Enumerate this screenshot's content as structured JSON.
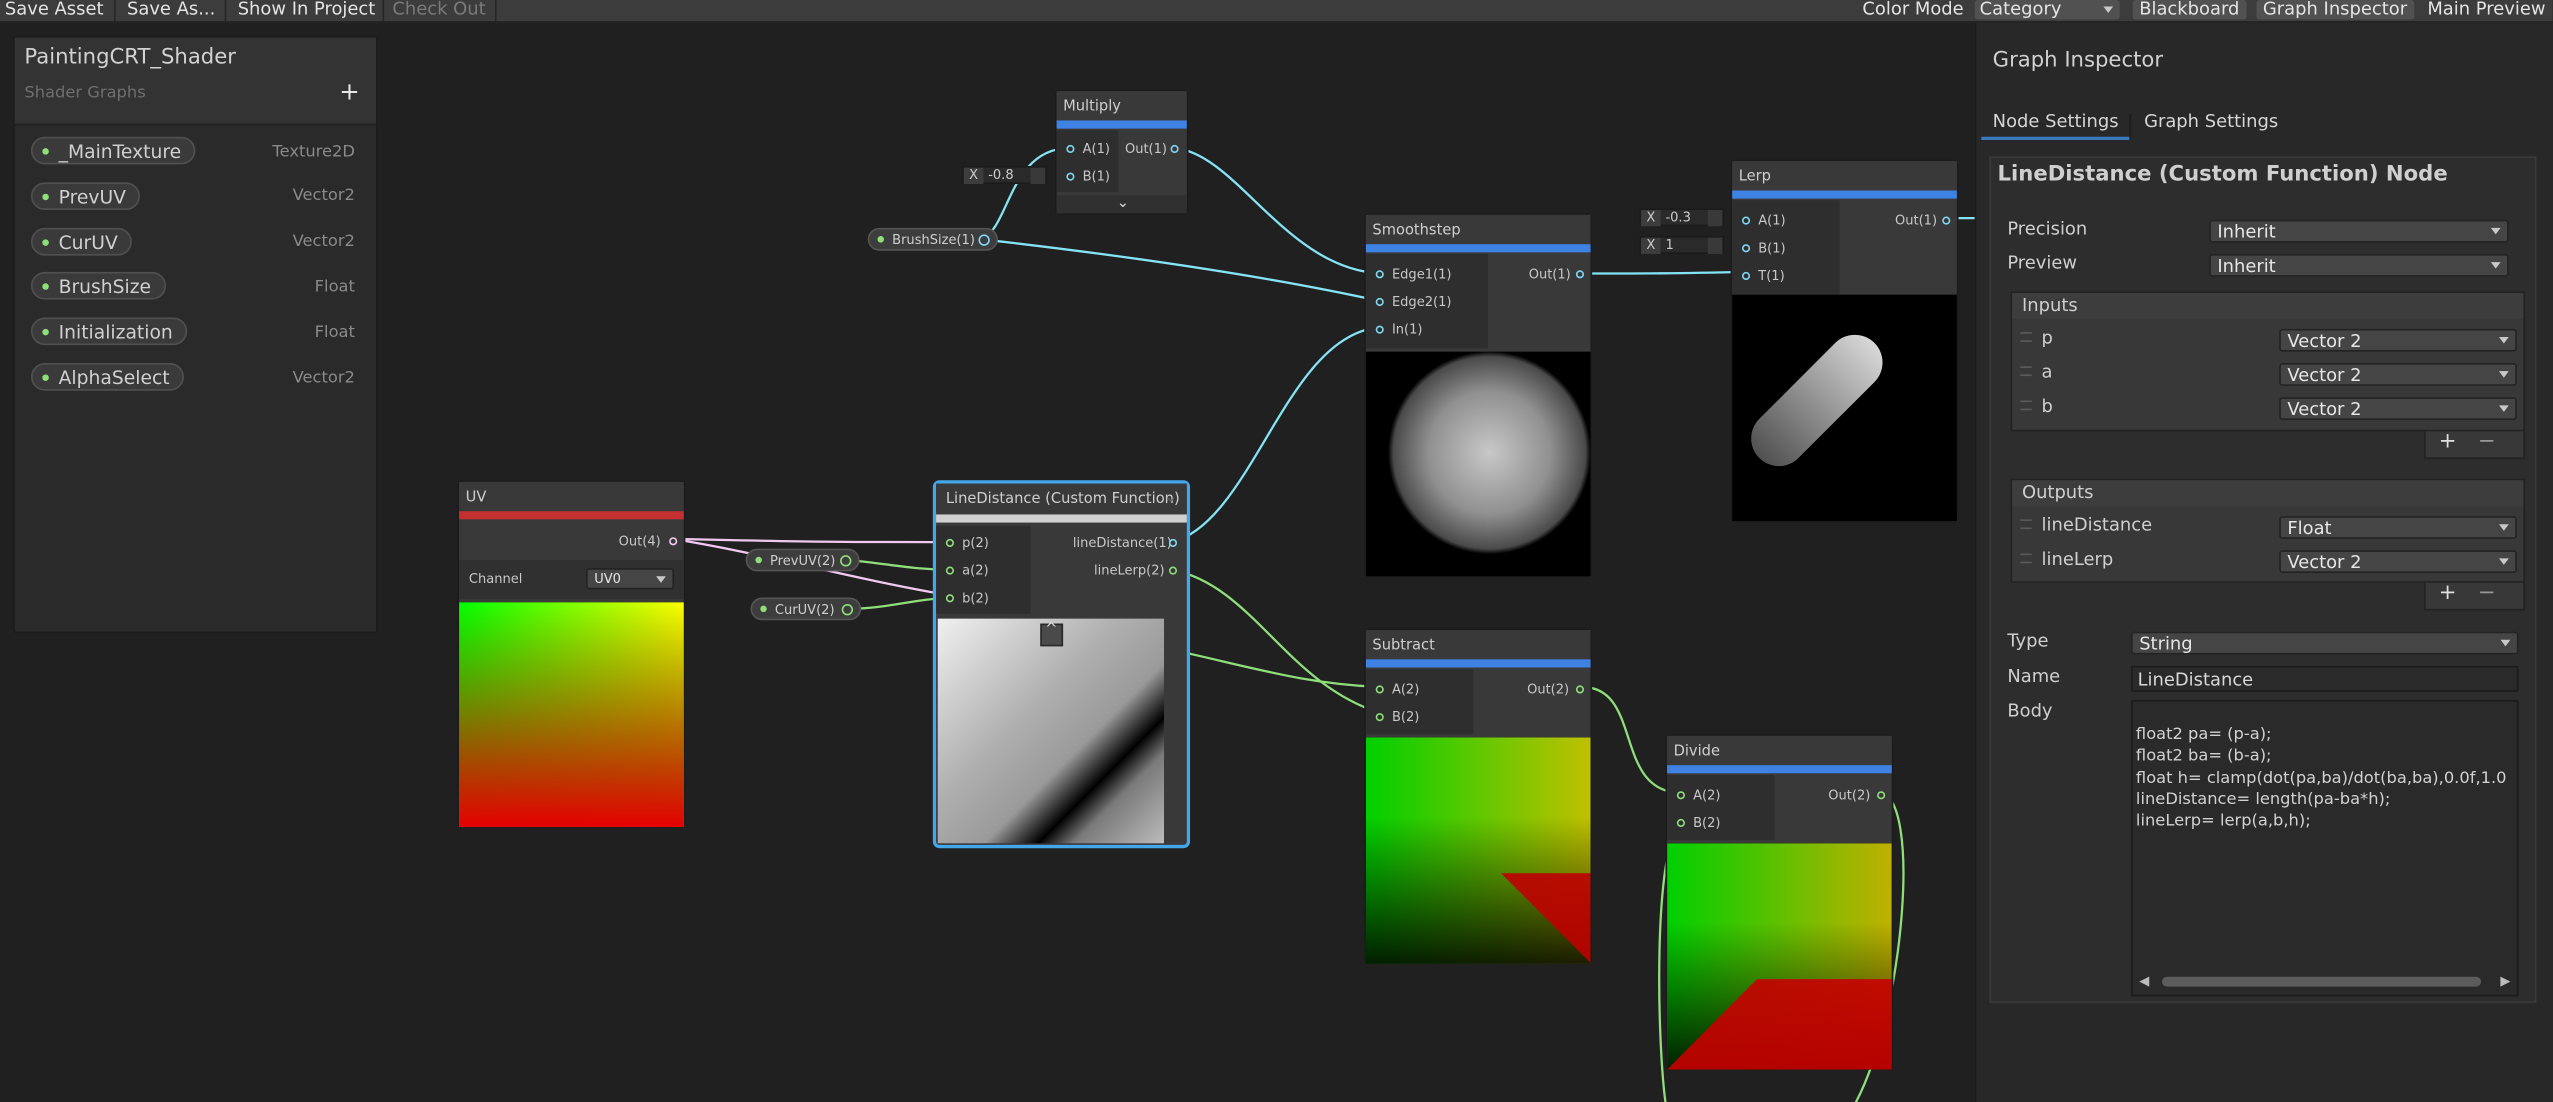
{
  "toolbar": {
    "save_asset": "Save Asset",
    "save_as": "Save As...",
    "show_in_project": "Show In Project",
    "check_out": "Check Out",
    "color_mode_label": "Color Mode",
    "color_mode_value": "Category",
    "blackboard": "Blackboard",
    "graph_inspector": "Graph Inspector",
    "main_preview": "Main Preview"
  },
  "blackboard": {
    "title": "PaintingCRT_Shader",
    "subtitle": "Shader Graphs",
    "add": "+",
    "properties": [
      {
        "name": "_MainTexture",
        "type": "Texture2D"
      },
      {
        "name": "PrevUV",
        "type": "Vector2"
      },
      {
        "name": "CurUV",
        "type": "Vector2"
      },
      {
        "name": "BrushSize",
        "type": "Float"
      },
      {
        "name": "Initialization",
        "type": "Float"
      },
      {
        "name": "AlphaSelect",
        "type": "Vector2"
      }
    ]
  },
  "nodes": {
    "multiply": {
      "title": "Multiply",
      "in_a": "A(1)",
      "in_b": "B(1)",
      "out": "Out(1)",
      "x_label": "X",
      "x_value": "-0.8"
    },
    "brushsize": {
      "label": "BrushSize(1)"
    },
    "smoothstep": {
      "title": "Smoothstep",
      "edge1": "Edge1(1)",
      "edge2": "Edge2(1)",
      "in": "In(1)",
      "out": "Out(1)"
    },
    "lerp": {
      "title": "Lerp",
      "a": "A(1)",
      "b": "B(1)",
      "t": "T(1)",
      "out": "Out(1)",
      "x_label": "X",
      "a_value": "-0.3",
      "b_value": "1"
    },
    "uv": {
      "title": "UV",
      "out": "Out(4)",
      "channel_label": "Channel",
      "channel_value": "UV0"
    },
    "prevuv": {
      "label": "PrevUV(2)"
    },
    "curuv": {
      "label": "CurUV(2)"
    },
    "linedistance": {
      "title": "LineDistance (Custom Function)",
      "p": "p(2)",
      "a": "a(2)",
      "b": "b(2)",
      "out1": "lineDistance(1)",
      "out2": "lineLerp(2)"
    },
    "subtract": {
      "title": "Subtract",
      "a": "A(2)",
      "b": "B(2)",
      "out": "Out(2)"
    },
    "divide": {
      "title": "Divide",
      "a": "A(2)",
      "b": "B(2)",
      "out": "Out(2)"
    }
  },
  "inspector": {
    "title": "Graph Inspector",
    "tabs": [
      "Node Settings",
      "Graph Settings"
    ],
    "node_title": "LineDistance (Custom Function) Node",
    "precision_label": "Precision",
    "precision_value": "Inherit",
    "preview_label": "Preview",
    "preview_value": "Inherit",
    "inputs_title": "Inputs",
    "inputs": [
      {
        "name": "p",
        "type": "Vector 2"
      },
      {
        "name": "a",
        "type": "Vector 2"
      },
      {
        "name": "b",
        "type": "Vector 2"
      }
    ],
    "outputs_title": "Outputs",
    "outputs": [
      {
        "name": "lineDistance",
        "type": "Float"
      },
      {
        "name": "lineLerp",
        "type": "Vector 2"
      }
    ],
    "plus": "+",
    "minus": "−",
    "type_label": "Type",
    "type_value": "String",
    "name_label": "Name",
    "name_value": "LineDistance",
    "body_label": "Body",
    "body_lines": [
      "float2 pa= (p-a);",
      "float2 ba= (b-a);",
      "float h= clamp(dot(pa,ba)/dot(ba,ba),0.0f,1.0",
      "lineDistance= length(pa-ba*h);",
      "lineLerp= lerp(a,b,h);"
    ]
  },
  "colors": {
    "float_wire": "#84e4f5",
    "vector2_wire": "#8ede7a",
    "vector4_wire": "#f0c8f0",
    "header_blue": "#3e82e4",
    "header_red": "#c43030",
    "selection": "#43a8ea"
  }
}
